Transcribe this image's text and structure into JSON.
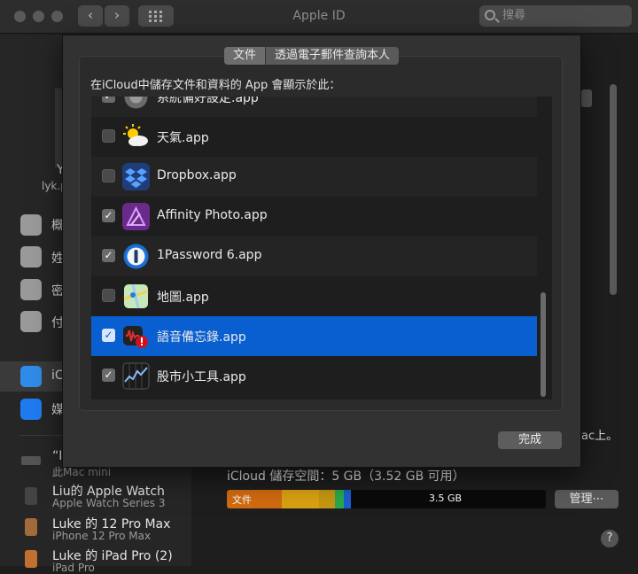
{
  "window": {
    "title": "Apple ID"
  },
  "toolbar": {
    "search_placeholder": "搜尋"
  },
  "sidebar": {
    "account_name": "Y",
    "account_email": "lyk.p",
    "items": [
      {
        "label": "概",
        "icon": "apple-icon"
      },
      {
        "label": "姓",
        "icon": "phone-icon"
      },
      {
        "label": "密",
        "icon": "lock-icon"
      },
      {
        "label": "付",
        "icon": "card-icon"
      },
      {
        "label": "iC",
        "icon": "icloud-icon"
      },
      {
        "label": "媒",
        "icon": "appstore-icon"
      }
    ],
    "devices": [
      {
        "name": "“I",
        "sub": "此Mac mini"
      },
      {
        "name": "Liu的 Apple Watch",
        "sub": "Apple Watch Series 3"
      },
      {
        "name": "Luke 的 12 Pro Max",
        "sub": "iPhone 12 Pro Max"
      },
      {
        "name": "Luke 的 iPad Pro (2)",
        "sub": "iPad Pro"
      }
    ]
  },
  "main": {
    "storage_label": "iCloud 儲存空間：5 GB（3.52 GB 可用）",
    "bar_doc_label": "文件",
    "bar_free_label": "3.5 GB",
    "manage_button": "管理⋯",
    "help": "?",
    "mac_peek": "ac上。"
  },
  "sheet": {
    "tabs": [
      {
        "label": "文件",
        "active": true
      },
      {
        "label": "透過電子郵件查詢本人",
        "active": false
      }
    ],
    "group_label": "在iCloud中儲存文件和資料的 App 會顯示於此：",
    "apps": [
      {
        "name": "系統偏好設定.app",
        "checked": true,
        "icon": "system-preferences-icon"
      },
      {
        "name": "天氣.app",
        "checked": false,
        "icon": "weather-icon"
      },
      {
        "name": "Dropbox.app",
        "checked": false,
        "icon": "dropbox-icon"
      },
      {
        "name": "Affinity Photo.app",
        "checked": true,
        "icon": "affinity-photo-icon"
      },
      {
        "name": "1Password 6.app",
        "checked": true,
        "icon": "1password-icon"
      },
      {
        "name": "地圖.app",
        "checked": false,
        "icon": "maps-icon"
      },
      {
        "name": "語音備忘錄.app",
        "checked": true,
        "icon": "voice-memos-icon",
        "selected": true
      },
      {
        "name": "股市小工具.app",
        "checked": true,
        "icon": "stocks-icon"
      }
    ],
    "done_button": "完成"
  },
  "colors": {
    "accent": "#0a5fd0",
    "bar_docs": "#d06a10",
    "bar_other1": "#d9a012",
    "bar_other2": "#c49612",
    "bar_green": "#2aa84a",
    "bar_blue": "#1a5fd0"
  }
}
